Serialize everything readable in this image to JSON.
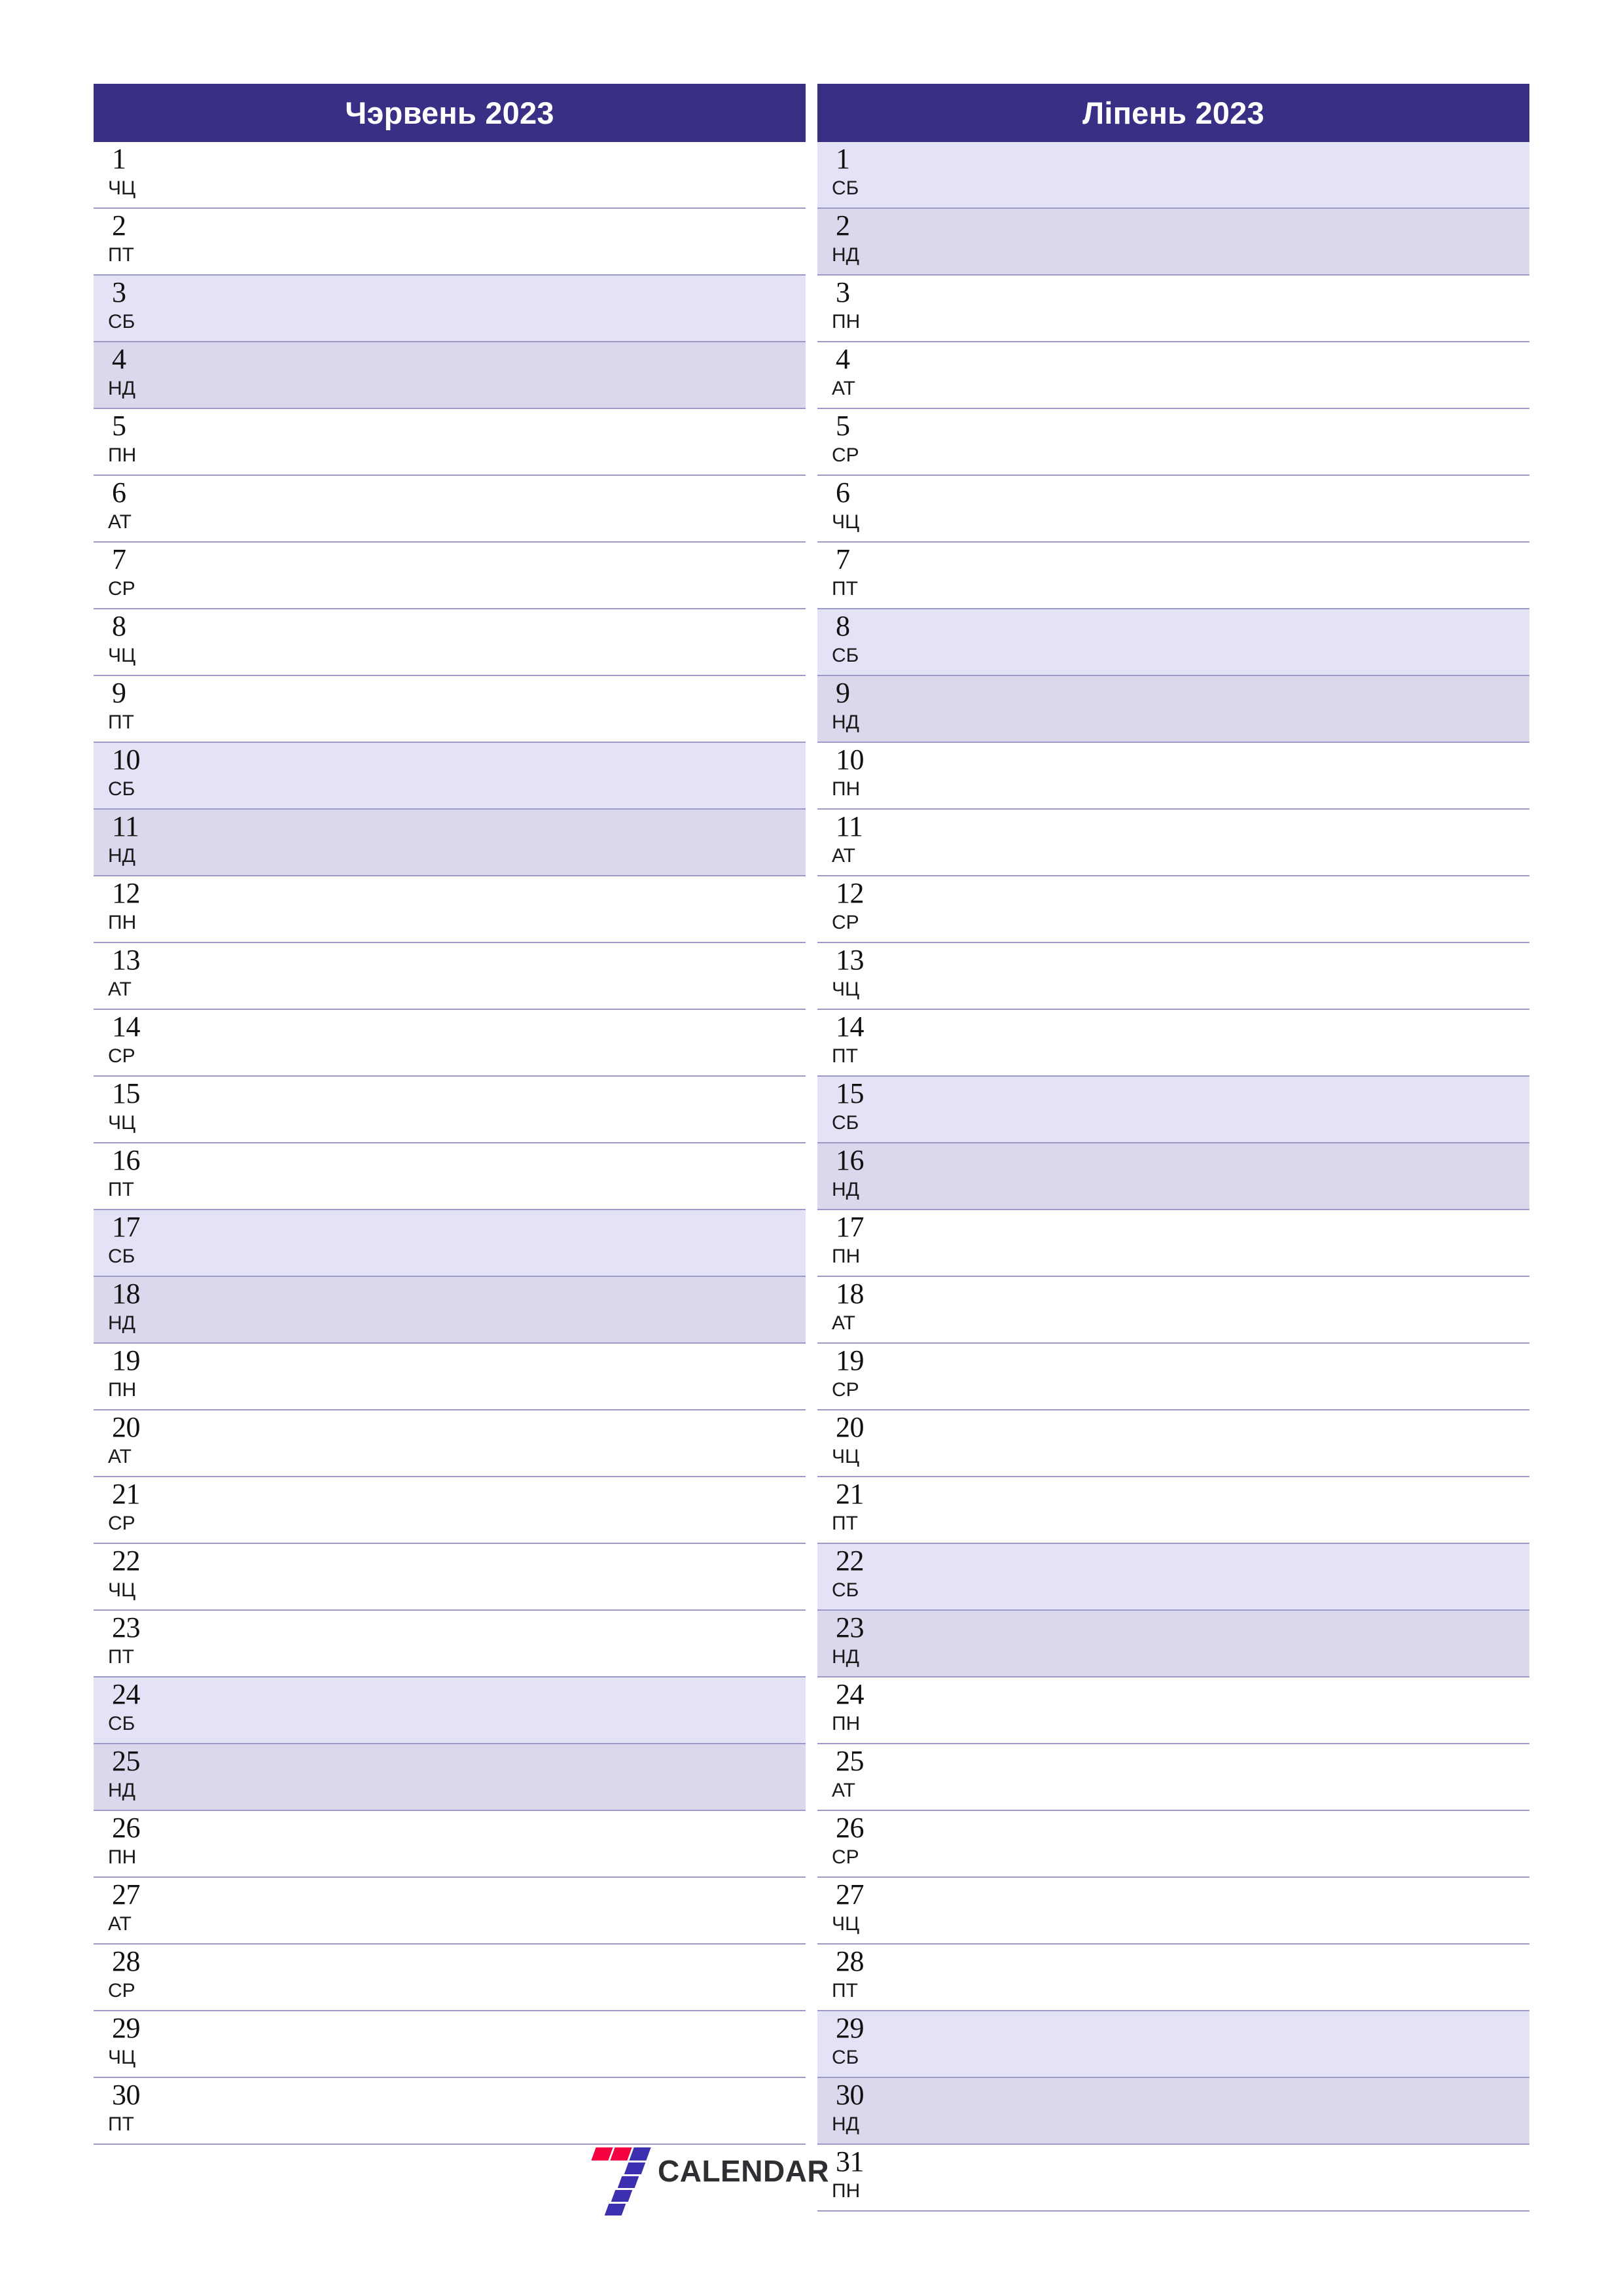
{
  "document": {
    "type": "two-month-planner",
    "year": "2023"
  },
  "colors": {
    "header_bg": "#393086",
    "header_text": "#ffffff",
    "saturday_bg": "#e3e2f6",
    "sunday_bg": "#dbd7ec",
    "row_separator": "#9b9ac9",
    "page_bg": "#ffffff",
    "logo_red": "#f50040",
    "logo_purple": "#3c2fb0",
    "logo_word": "#2f2f33"
  },
  "months": [
    {
      "title": "Чэрвень 2023",
      "days": [
        {
          "num": "1",
          "abbr": "ЧЦ",
          "kind": "weekday"
        },
        {
          "num": "2",
          "abbr": "ПТ",
          "kind": "weekday"
        },
        {
          "num": "3",
          "abbr": "СБ",
          "kind": "sat"
        },
        {
          "num": "4",
          "abbr": "НД",
          "kind": "sun"
        },
        {
          "num": "5",
          "abbr": "ПН",
          "kind": "weekday"
        },
        {
          "num": "6",
          "abbr": "АТ",
          "kind": "weekday"
        },
        {
          "num": "7",
          "abbr": "СР",
          "kind": "weekday"
        },
        {
          "num": "8",
          "abbr": "ЧЦ",
          "kind": "weekday"
        },
        {
          "num": "9",
          "abbr": "ПТ",
          "kind": "weekday"
        },
        {
          "num": "10",
          "abbr": "СБ",
          "kind": "sat"
        },
        {
          "num": "11",
          "abbr": "НД",
          "kind": "sun"
        },
        {
          "num": "12",
          "abbr": "ПН",
          "kind": "weekday"
        },
        {
          "num": "13",
          "abbr": "АТ",
          "kind": "weekday"
        },
        {
          "num": "14",
          "abbr": "СР",
          "kind": "weekday"
        },
        {
          "num": "15",
          "abbr": "ЧЦ",
          "kind": "weekday"
        },
        {
          "num": "16",
          "abbr": "ПТ",
          "kind": "weekday"
        },
        {
          "num": "17",
          "abbr": "СБ",
          "kind": "sat"
        },
        {
          "num": "18",
          "abbr": "НД",
          "kind": "sun"
        },
        {
          "num": "19",
          "abbr": "ПН",
          "kind": "weekday"
        },
        {
          "num": "20",
          "abbr": "АТ",
          "kind": "weekday"
        },
        {
          "num": "21",
          "abbr": "СР",
          "kind": "weekday"
        },
        {
          "num": "22",
          "abbr": "ЧЦ",
          "kind": "weekday"
        },
        {
          "num": "23",
          "abbr": "ПТ",
          "kind": "weekday"
        },
        {
          "num": "24",
          "abbr": "СБ",
          "kind": "sat"
        },
        {
          "num": "25",
          "abbr": "НД",
          "kind": "sun"
        },
        {
          "num": "26",
          "abbr": "ПН",
          "kind": "weekday"
        },
        {
          "num": "27",
          "abbr": "АТ",
          "kind": "weekday"
        },
        {
          "num": "28",
          "abbr": "СР",
          "kind": "weekday"
        },
        {
          "num": "29",
          "abbr": "ЧЦ",
          "kind": "weekday"
        },
        {
          "num": "30",
          "abbr": "ПТ",
          "kind": "weekday"
        }
      ]
    },
    {
      "title": "Ліпень 2023",
      "days": [
        {
          "num": "1",
          "abbr": "СБ",
          "kind": "sat"
        },
        {
          "num": "2",
          "abbr": "НД",
          "kind": "sun"
        },
        {
          "num": "3",
          "abbr": "ПН",
          "kind": "weekday"
        },
        {
          "num": "4",
          "abbr": "АТ",
          "kind": "weekday"
        },
        {
          "num": "5",
          "abbr": "СР",
          "kind": "weekday"
        },
        {
          "num": "6",
          "abbr": "ЧЦ",
          "kind": "weekday"
        },
        {
          "num": "7",
          "abbr": "ПТ",
          "kind": "weekday"
        },
        {
          "num": "8",
          "abbr": "СБ",
          "kind": "sat"
        },
        {
          "num": "9",
          "abbr": "НД",
          "kind": "sun"
        },
        {
          "num": "10",
          "abbr": "ПН",
          "kind": "weekday"
        },
        {
          "num": "11",
          "abbr": "АТ",
          "kind": "weekday"
        },
        {
          "num": "12",
          "abbr": "СР",
          "kind": "weekday"
        },
        {
          "num": "13",
          "abbr": "ЧЦ",
          "kind": "weekday"
        },
        {
          "num": "14",
          "abbr": "ПТ",
          "kind": "weekday"
        },
        {
          "num": "15",
          "abbr": "СБ",
          "kind": "sat"
        },
        {
          "num": "16",
          "abbr": "НД",
          "kind": "sun"
        },
        {
          "num": "17",
          "abbr": "ПН",
          "kind": "weekday"
        },
        {
          "num": "18",
          "abbr": "АТ",
          "kind": "weekday"
        },
        {
          "num": "19",
          "abbr": "СР",
          "kind": "weekday"
        },
        {
          "num": "20",
          "abbr": "ЧЦ",
          "kind": "weekday"
        },
        {
          "num": "21",
          "abbr": "ПТ",
          "kind": "weekday"
        },
        {
          "num": "22",
          "abbr": "СБ",
          "kind": "sat"
        },
        {
          "num": "23",
          "abbr": "НД",
          "kind": "sun"
        },
        {
          "num": "24",
          "abbr": "ПН",
          "kind": "weekday"
        },
        {
          "num": "25",
          "abbr": "АТ",
          "kind": "weekday"
        },
        {
          "num": "26",
          "abbr": "СР",
          "kind": "weekday"
        },
        {
          "num": "27",
          "abbr": "ЧЦ",
          "kind": "weekday"
        },
        {
          "num": "28",
          "abbr": "ПТ",
          "kind": "weekday"
        },
        {
          "num": "29",
          "abbr": "СБ",
          "kind": "sat"
        },
        {
          "num": "30",
          "abbr": "НД",
          "kind": "sun"
        },
        {
          "num": "31",
          "abbr": "ПН",
          "kind": "weekday"
        }
      ]
    }
  ],
  "footer": {
    "logo_mark": "seven-logo-icon",
    "logo_text": "CALENDAR"
  }
}
